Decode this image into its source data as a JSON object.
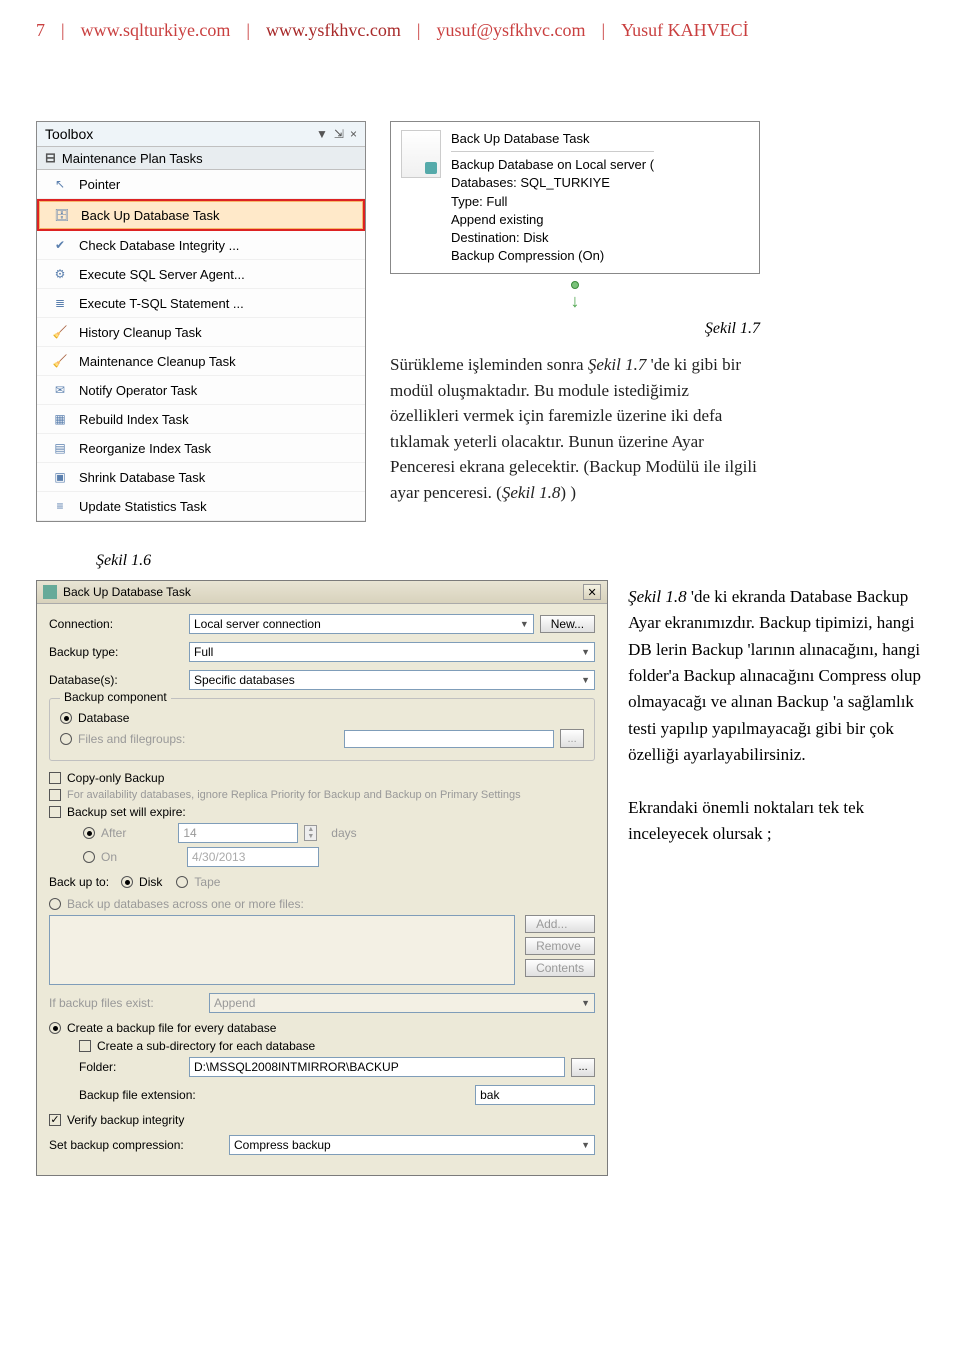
{
  "header": {
    "pageNum": "7",
    "sep": "|",
    "url1": "www.sqlturkiye.com",
    "url2": "www.ysfkhvc.com",
    "email": "yusuf@ysfkhvc.com",
    "name": "Yusuf KAHVECİ"
  },
  "toolbox": {
    "title": "Toolbox",
    "dropdownGlyph": "▼",
    "pinGlyph": "⇲",
    "closeGlyph": "×",
    "section": "Maintenance Plan Tasks",
    "items": [
      {
        "label": "Pointer",
        "glyph": "↖"
      },
      {
        "label": "Back Up Database Task",
        "glyph": "🗄",
        "highlight": true
      },
      {
        "label": "Check Database Integrity ...",
        "glyph": "✔"
      },
      {
        "label": "Execute SQL Server Agent...",
        "glyph": "⚙"
      },
      {
        "label": "Execute T-SQL Statement ...",
        "glyph": "≣"
      },
      {
        "label": "History Cleanup Task",
        "glyph": "🧹"
      },
      {
        "label": "Maintenance Cleanup Task",
        "glyph": "🧹"
      },
      {
        "label": "Notify Operator Task",
        "glyph": "✉"
      },
      {
        "label": "Rebuild Index Task",
        "glyph": "▦"
      },
      {
        "label": "Reorganize Index Task",
        "glyph": "▤"
      },
      {
        "label": "Shrink Database Task",
        "glyph": "▣"
      },
      {
        "label": "Update Statistics Task",
        "glyph": "≡"
      }
    ]
  },
  "captions": {
    "s17": "Şekil 1.7",
    "s16": "Şekil 1.6"
  },
  "node": {
    "title": "Back Up Database Task",
    "lines": [
      "Backup Database on Local server (",
      "Databases: SQL_TURKIYE",
      "Type: Full",
      "Append existing",
      "Destination: Disk",
      "Backup Compression (On)"
    ]
  },
  "para1_html": "Sürükleme işleminden sonra <i>Şekil 1.7</i> 'de ki gibi bir modül oluşmaktadır. Bu module istediğimiz özellikleri vermek için faremizle üzerine iki defa tıklamak yeterli olacaktır. Bunun üzerine Ayar Penceresi ekrana gelecektir. (Backup Modülü ile ilgili ayar penceresi. (<i>Şekil 1.8</i>) )",
  "para2_html": "<i>Şekil 1.8</i> 'de ki ekranda Database Backup Ayar ekranımızdır. Backup tipimizi, hangi DB lerin Backup 'larının alınacağını, hangi folder'a Backup alınacağını Compress olup olmayacağı ve alınan Backup 'a sağlamlık testi yapılıp yapılmayacağı gibi bir çok özelliği ayarlayabilirsiniz.<br><br>Ekrandaki önemli noktaları tek tek inceleyecek olursak ;",
  "dialog": {
    "title": "Back Up Database Task",
    "close": "✕",
    "connection": {
      "label": "Connection:",
      "value": "Local server connection",
      "newBtn": "New..."
    },
    "backupType": {
      "label": "Backup type:",
      "value": "Full"
    },
    "databases": {
      "label": "Database(s):",
      "value": "Specific databases"
    },
    "component": {
      "legend": "Backup component",
      "database": "Database",
      "filesgroups": "Files and filegroups:"
    },
    "copyOnly": "Copy-only Backup",
    "availText": "For availability databases, ignore Replica Priority for Backup and Backup on Primary Settings",
    "expire": {
      "label": "Backup set will expire:",
      "after": "After",
      "afterVal": "14",
      "days": "days",
      "on": "On",
      "onVal": "4/30/2013"
    },
    "backupTo": {
      "label": "Back up to:",
      "disk": "Disk",
      "tape": "Tape"
    },
    "across": {
      "label": "Back up databases across one or more files:"
    },
    "buttons": {
      "add": "Add...",
      "remove": "Remove",
      "contents": "Contents"
    },
    "ifExist": {
      "label": "If backup files exist:",
      "value": "Append"
    },
    "createFile": "Create a backup file for every database",
    "subDir": "Create a sub-directory for each database",
    "folder": {
      "label": "Folder:",
      "value": "D:\\MSSQL2008INTMIRROR\\BACKUP"
    },
    "ext": {
      "label": "Backup file extension:",
      "value": "bak"
    },
    "verify": "Verify backup integrity",
    "compress": {
      "label": "Set backup compression:",
      "value": "Compress backup"
    }
  }
}
